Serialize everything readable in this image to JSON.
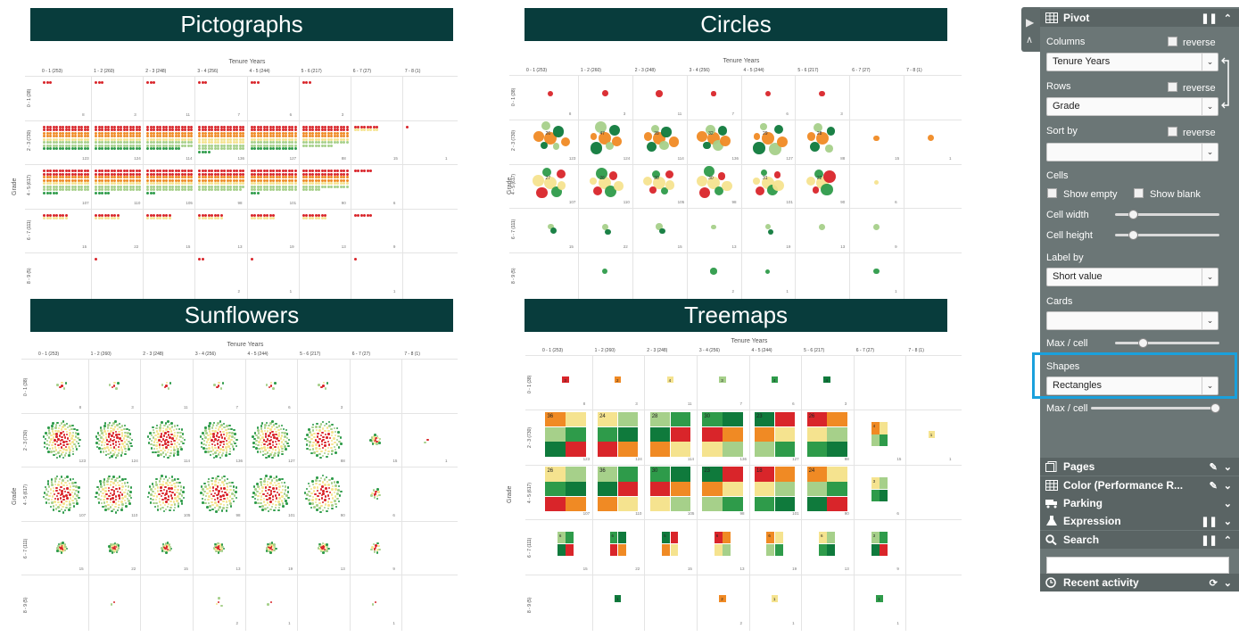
{
  "banners": {
    "pictographs": "Pictographs",
    "circles": "Circles",
    "sunflowers": "Sunflowers",
    "treemaps": "Treemaps"
  },
  "pivot": {
    "col_title": "Tenure Years",
    "row_title": "Grade",
    "columns": [
      {
        "label": "0 - 1",
        "count": "(253)"
      },
      {
        "label": "1 - 2",
        "count": "(260)"
      },
      {
        "label": "2 - 3",
        "count": "(248)"
      },
      {
        "label": "3 - 4",
        "count": "(256)"
      },
      {
        "label": "4 - 5",
        "count": "(244)"
      },
      {
        "label": "5 - 6",
        "count": "(217)"
      },
      {
        "label": "6 - 7",
        "count": "(27)"
      },
      {
        "label": "7 - 8",
        "count": "(1)"
      }
    ],
    "rows": [
      {
        "label": "0 - 1",
        "count": "(38)"
      },
      {
        "label": "2 - 3",
        "count": "(730)"
      },
      {
        "label": "4 - 5",
        "count": "(617)"
      },
      {
        "label": "6 - 7",
        "count": "(111)"
      },
      {
        "label": "8 - 9",
        "count": "(5)"
      }
    ],
    "cell_counts": [
      [
        "8",
        "3",
        "11",
        "7",
        "6",
        "3",
        "",
        ""
      ],
      [
        "123",
        "124",
        "114",
        "136",
        "127",
        "88",
        "15",
        "1"
      ],
      [
        "107",
        "110",
        "105",
        "98",
        "101",
        "90",
        "6",
        ""
      ],
      [
        "15",
        "22",
        "15",
        "13",
        "19",
        "13",
        "9",
        ""
      ],
      [
        "",
        "",
        "",
        "2",
        "1",
        "",
        "1",
        ""
      ]
    ],
    "circle_labels": [
      [
        "",
        "",
        "",
        "",
        "",
        "",
        "",
        ""
      ],
      [
        "26",
        "47",
        "28",
        "32",
        "29",
        "28",
        "",
        ""
      ],
      [
        "27",
        "26",
        "30",
        "30",
        "31",
        "22",
        "",
        ""
      ],
      [
        "",
        "",
        "",
        "",
        "",
        "",
        "",
        ""
      ],
      [
        "",
        "",
        "",
        "",
        "",
        "",
        "",
        ""
      ]
    ],
    "treemap_labels": [
      [
        "3",
        "2",
        "4",
        "3",
        "4",
        "4",
        "",
        ""
      ],
      [
        "36",
        "24",
        "28",
        "30",
        "23",
        "26",
        "4",
        "1"
      ],
      [
        "26",
        "36",
        "30",
        "23",
        "18",
        "24",
        "3",
        ""
      ],
      [
        "6",
        "6",
        "5",
        "6",
        "6",
        "6",
        "3",
        ""
      ],
      [
        "",
        "1",
        "",
        "2",
        "1",
        "",
        "1",
        ""
      ]
    ]
  },
  "colors": {
    "banner": "#083c3c",
    "red": "#d9252a",
    "orange": "#f08a24",
    "yellow": "#f5e38f",
    "lightgreen": "#a6d08a",
    "green": "#2e9b4a",
    "darkgreen": "#0f7a3c",
    "highlight": "#1aa0dc"
  },
  "panel": {
    "title": "Pivot",
    "columns_label": "Columns",
    "columns_value": "Tenure Years",
    "reverse_label": "reverse",
    "rows_label": "Rows",
    "rows_value": "Grade",
    "sortby_label": "Sort by",
    "sortby_value": "",
    "cells_label": "Cells",
    "show_empty": "Show empty",
    "show_blank": "Show blank",
    "cell_width": "Cell width",
    "cell_height": "Cell height",
    "labelby_label": "Label by",
    "labelby_value": "Short value",
    "cards_label": "Cards",
    "cards_value": "",
    "maxcell_label": "Max / cell",
    "shapes_label": "Shapes",
    "shapes_value": "Rectangles",
    "maxcell2_label": "Max / cell",
    "sections": [
      "Pages",
      "Color (Performance R...",
      "Parking",
      "Expression",
      "Search"
    ],
    "search_value": "",
    "recent": "Recent activity"
  }
}
